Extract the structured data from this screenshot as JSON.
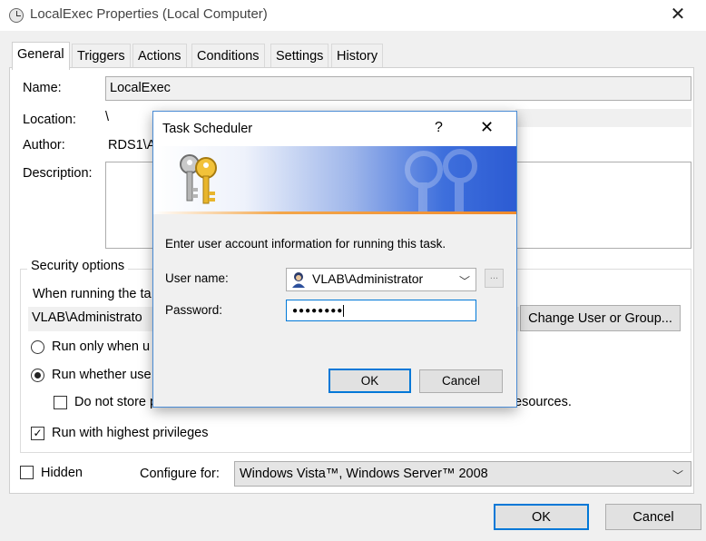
{
  "window": {
    "title": "LocalExec Properties (Local Computer)",
    "close_glyph": "✕"
  },
  "tabs": [
    "General",
    "Triggers",
    "Actions",
    "Conditions",
    "Settings",
    "History"
  ],
  "general": {
    "name_label": "Name:",
    "name_value": "LocalExec",
    "location_label": "Location:",
    "location_value": "\\",
    "author_label": "Author:",
    "author_value": "RDS1\\A",
    "description_label": "Description:",
    "description_value": ""
  },
  "security": {
    "title": "Security options",
    "when_running_text": "When running the ta",
    "account_value": "VLAB\\Administrato",
    "change_user_button": "Change User or Group...",
    "radio_logged_on": "Run only when u",
    "radio_whether": "Run whether use",
    "do_not_store_left": "Do not store pa",
    "do_not_store_right": "esources.",
    "run_highest": "Run with highest privileges"
  },
  "footer": {
    "hidden_label": "Hidden",
    "configure_label": "Configure for:",
    "configure_value": "Windows Vista™, Windows Server™ 2008",
    "ok": "OK",
    "cancel": "Cancel"
  },
  "dialog": {
    "title": "Task Scheduler",
    "help_glyph": "?",
    "close_glyph": "✕",
    "instruction": "Enter user account information for running this task.",
    "username_label": "User name:",
    "username_value": "VLAB\\Administrator",
    "password_label": "Password:",
    "password_value": "●●●●●●●●",
    "ellipsis": "...",
    "ok": "OK",
    "cancel": "Cancel"
  },
  "colors": {
    "accent": "#0078d7",
    "banner_blue": "#2c5bd3",
    "banner_orange": "#f08a2c"
  },
  "icons": [
    "clock-icon",
    "keys-icon",
    "user-icon",
    "chevron-down-icon",
    "close-icon",
    "help-icon"
  ]
}
